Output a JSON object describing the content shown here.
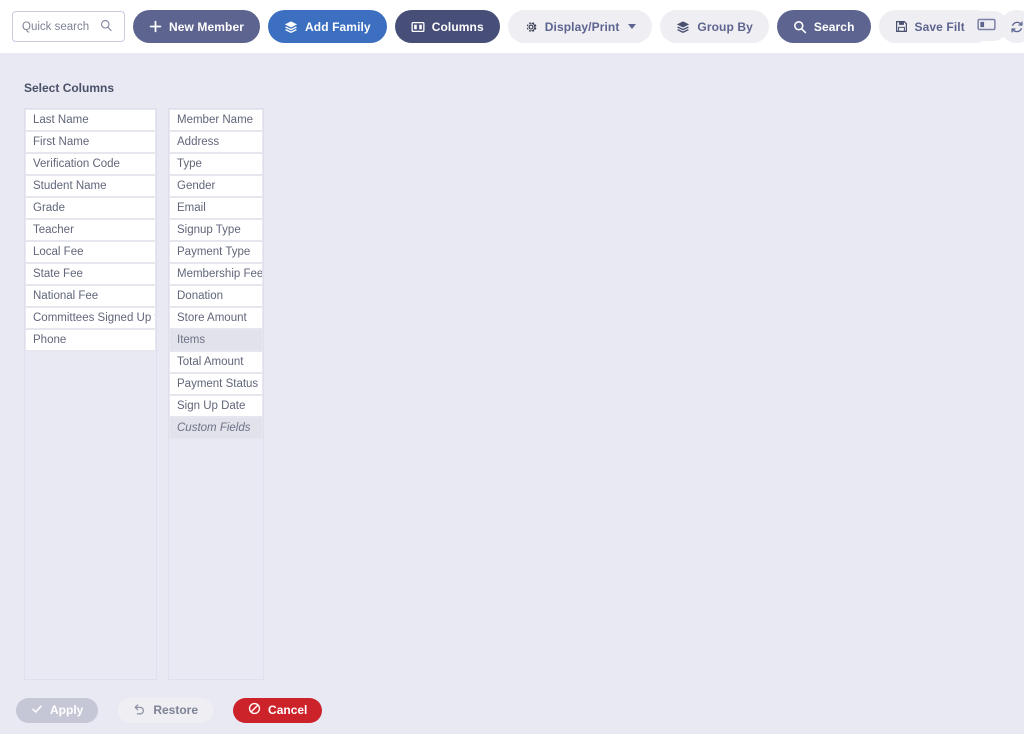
{
  "toolbar": {
    "search": {
      "value": "",
      "placeholder": "Quick search",
      "icon": "search-icon"
    },
    "buttons": [
      {
        "label": "New Member",
        "icon": "plus-icon",
        "style": "slate"
      },
      {
        "label": "Add Family",
        "icon": "layers-icon",
        "style": "blue"
      },
      {
        "label": "Columns",
        "icon": "columns-icon",
        "style": "navy"
      },
      {
        "label": "Display/Print",
        "icon": "gear-icon",
        "style": "ghost",
        "caret": true
      },
      {
        "label": "Group By",
        "icon": "layers-icon",
        "style": "ghost"
      },
      {
        "label": "Search",
        "icon": "search-icon",
        "style": "search"
      },
      {
        "label": "Save Filter",
        "icon": "save-icon",
        "style": "ghost"
      },
      {
        "label": "",
        "icon": "refresh-icon",
        "style": "icon-only"
      }
    ],
    "layout_toggle": {
      "icon": "panel-layout-icon"
    }
  },
  "panel": {
    "title": "Select Columns",
    "left_column": [
      {
        "label": "Last Name",
        "selected": false,
        "italic": false
      },
      {
        "label": "First Name",
        "selected": false,
        "italic": false
      },
      {
        "label": "Verification Code",
        "selected": false,
        "italic": false
      },
      {
        "label": "Student Name",
        "selected": false,
        "italic": false
      },
      {
        "label": "Grade",
        "selected": false,
        "italic": false
      },
      {
        "label": "Teacher",
        "selected": false,
        "italic": false
      },
      {
        "label": "Local Fee",
        "selected": false,
        "italic": false
      },
      {
        "label": "State Fee",
        "selected": false,
        "italic": false
      },
      {
        "label": "National Fee",
        "selected": false,
        "italic": false
      },
      {
        "label": "Committees Signed Up for",
        "selected": false,
        "italic": false
      },
      {
        "label": "Phone",
        "selected": false,
        "italic": false
      }
    ],
    "right_column": [
      {
        "label": "Member Name",
        "selected": false,
        "italic": false
      },
      {
        "label": "Address",
        "selected": false,
        "italic": false
      },
      {
        "label": "Type",
        "selected": false,
        "italic": false
      },
      {
        "label": "Gender",
        "selected": false,
        "italic": false
      },
      {
        "label": "Email",
        "selected": false,
        "italic": false
      },
      {
        "label": "Signup Type",
        "selected": false,
        "italic": false
      },
      {
        "label": "Payment Type",
        "selected": false,
        "italic": false
      },
      {
        "label": "Membership Fee",
        "selected": false,
        "italic": false
      },
      {
        "label": "Donation",
        "selected": false,
        "italic": false
      },
      {
        "label": "Store Amount",
        "selected": false,
        "italic": false
      },
      {
        "label": "Items",
        "selected": true,
        "italic": false
      },
      {
        "label": "Total Amount",
        "selected": false,
        "italic": false
      },
      {
        "label": "Payment Status",
        "selected": false,
        "italic": false
      },
      {
        "label": "Sign Up Date",
        "selected": false,
        "italic": false
      },
      {
        "label": "Custom Fields",
        "selected": true,
        "italic": true
      }
    ]
  },
  "footer": {
    "apply": {
      "label": "Apply",
      "icon": "check-icon",
      "disabled": true
    },
    "restore": {
      "label": "Restore",
      "icon": "undo-icon"
    },
    "cancel": {
      "label": "Cancel",
      "icon": "ban-icon"
    }
  },
  "colors": {
    "page_background": "#e9e9f3",
    "toolbar_background": "#ffffff",
    "accent_slate": "#5d6490",
    "accent_blue": "#3c6fc0",
    "accent_navy": "#474e78",
    "ghost": "#eeeef3",
    "cancel_red": "#cc2229",
    "apply_disabled": "#c6c7d6",
    "selected_item": "#e2e2ea"
  }
}
